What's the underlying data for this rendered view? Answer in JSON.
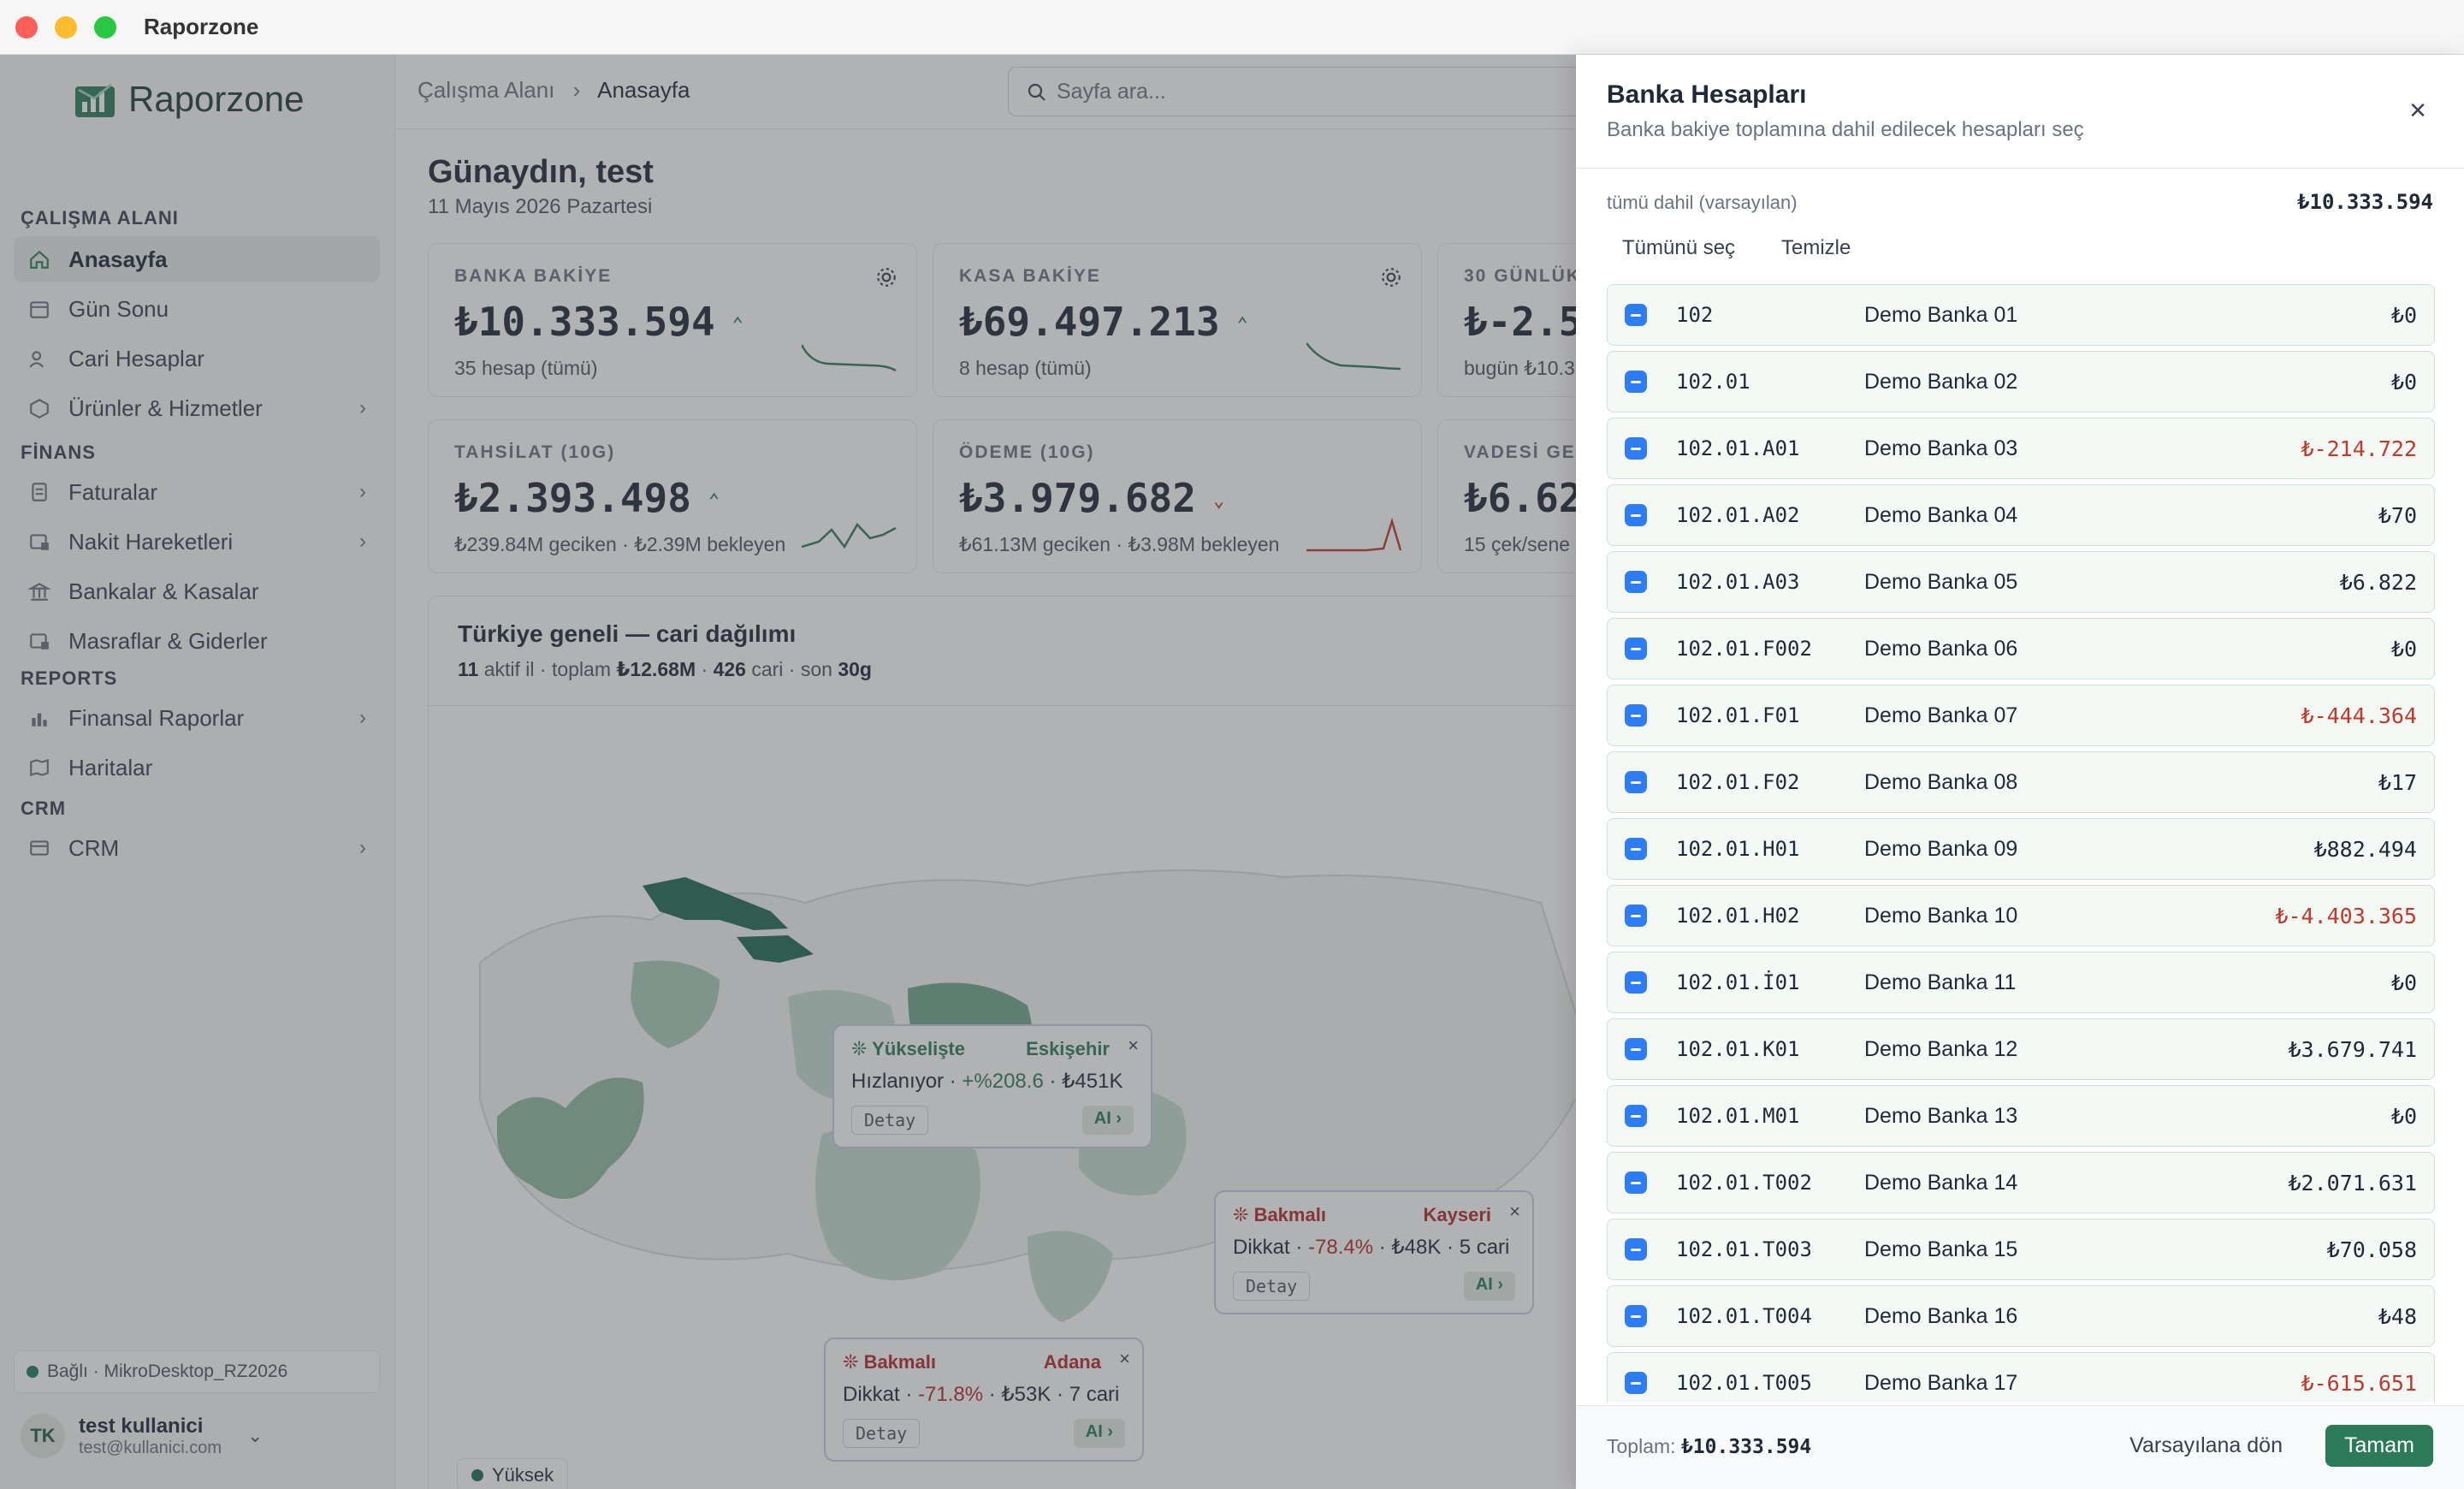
{
  "window": {
    "title": "Raporzone"
  },
  "sidebar": {
    "logo": "Raporzone",
    "sections": [
      {
        "title": "ÇALIŞMA ALANI",
        "items": [
          {
            "label": "Anasayfa",
            "icon": "home-icon",
            "active": true,
            "chevron": false
          },
          {
            "label": "Gün Sonu",
            "icon": "calendar-icon",
            "chevron": false
          },
          {
            "label": "Cari Hesaplar",
            "icon": "users-icon",
            "chevron": false
          },
          {
            "label": "Ürünler & Hizmetler",
            "icon": "box-icon",
            "chevron": true
          }
        ]
      },
      {
        "title": "FİNANS",
        "items": [
          {
            "label": "Faturalar",
            "icon": "invoice-icon",
            "chevron": true
          },
          {
            "label": "Nakit Hareketleri",
            "icon": "cash-icon",
            "chevron": true
          },
          {
            "label": "Bankalar & Kasalar",
            "icon": "bank-icon",
            "chevron": false
          },
          {
            "label": "Masraflar & Giderler",
            "icon": "expense-icon",
            "chevron": false
          }
        ]
      },
      {
        "title": "REPORTS",
        "items": [
          {
            "label": "Finansal Raporlar",
            "icon": "bar-chart-icon",
            "chevron": true
          },
          {
            "label": "Haritalar",
            "icon": "map-icon",
            "chevron": false
          }
        ]
      },
      {
        "title": "CRM",
        "items": [
          {
            "label": "CRM",
            "icon": "crm-icon",
            "chevron": true
          }
        ]
      }
    ],
    "connection": "Bağlı · MikroDesktop_RZ2026",
    "user": {
      "initials": "TK",
      "name": "test kullanici",
      "email": "test@kullanici.com"
    }
  },
  "main": {
    "breadcrumb": {
      "root": "Çalışma Alanı",
      "current": "Anasayfa"
    },
    "search_placeholder": "Sayfa ara...",
    "greeting": "Günaydın, test",
    "date": "11 Mayıs 2026 Pazartesi",
    "cards": [
      {
        "title": "BANKA BAKİYE",
        "value": "₺10.333.594",
        "sub": "35 hesap (tümü)",
        "trend": "up",
        "settings": true
      },
      {
        "title": "KASA BAKİYE",
        "value": "₺69.497.213",
        "sub": "8 hesap (tümü)",
        "trend": "up",
        "settings": true
      },
      {
        "title": "30 GÜNLÜK",
        "value": "₺-2.5",
        "sub": "bugün ₺10.3",
        "trend": "",
        "settings": false
      },
      {
        "title": "TAHSİLAT (10G)",
        "value": "₺2.393.498",
        "sub": "₺239.84M geciken · ₺2.39M bekleyen",
        "trend": "up",
        "settings": false
      },
      {
        "title": "ÖDEME (10G)",
        "value": "₺3.979.682",
        "sub": "₺61.13M geciken · ₺3.98M bekleyen",
        "trend": "down",
        "settings": false
      },
      {
        "title": "VADESİ GEÇ",
        "value": "₺6.62",
        "sub": "15 çek/sene",
        "trend": "",
        "settings": false
      }
    ],
    "map": {
      "title": "Türkiye geneli — cari dağılımı",
      "sub": {
        "provinces": "11",
        "provinces_label": "aktif il",
        "total_label": "toplam",
        "total": "₺12.68M",
        "count": "426",
        "count_label": "cari",
        "period_label": "son",
        "period": "30g"
      },
      "popups": [
        {
          "tag": "Yükselişte",
          "city": "Eskişehir",
          "label": "Hızlanıyor",
          "change": "+%208.6",
          "rest": "₺451K",
          "detail": "Detay",
          "ai": "AI",
          "tone": "up"
        },
        {
          "tag": "Bakmalı",
          "city": "Kayseri",
          "label": "Dikkat",
          "change": "-78.4%",
          "rest": "₺48K · 5 cari",
          "detail": "Detay",
          "ai": "AI",
          "tone": "down"
        },
        {
          "tag": "Bakmalı",
          "city": "Adana",
          "label": "Dikkat",
          "change": "-71.8%",
          "rest": "₺53K · 7 cari",
          "detail": "Detay",
          "ai": "AI",
          "tone": "down"
        }
      ],
      "legend": "Yüksek"
    }
  },
  "panel": {
    "title": "Banka Hesapları",
    "subtitle": "Banka bakiye toplamına dahil edilecek hesapları seç",
    "include_label": "tümü dahil (varsayılan)",
    "include_total": "₺10.333.594",
    "select_all": "Tümünü seç",
    "clear": "Temizle",
    "accounts": [
      {
        "code": "102",
        "name": "Demo Banka 01",
        "amount": "₺0",
        "neg": false
      },
      {
        "code": "102.01",
        "name": "Demo Banka 02",
        "amount": "₺0",
        "neg": false
      },
      {
        "code": "102.01.A01",
        "name": "Demo Banka 03",
        "amount": "₺-214.722",
        "neg": true
      },
      {
        "code": "102.01.A02",
        "name": "Demo Banka 04",
        "amount": "₺70",
        "neg": false
      },
      {
        "code": "102.01.A03",
        "name": "Demo Banka 05",
        "amount": "₺6.822",
        "neg": false
      },
      {
        "code": "102.01.F002",
        "name": "Demo Banka 06",
        "amount": "₺0",
        "neg": false
      },
      {
        "code": "102.01.F01",
        "name": "Demo Banka 07",
        "amount": "₺-444.364",
        "neg": true
      },
      {
        "code": "102.01.F02",
        "name": "Demo Banka 08",
        "amount": "₺17",
        "neg": false
      },
      {
        "code": "102.01.H01",
        "name": "Demo Banka 09",
        "amount": "₺882.494",
        "neg": false
      },
      {
        "code": "102.01.H02",
        "name": "Demo Banka 10",
        "amount": "₺-4.403.365",
        "neg": true
      },
      {
        "code": "102.01.İ01",
        "name": "Demo Banka 11",
        "amount": "₺0",
        "neg": false
      },
      {
        "code": "102.01.K01",
        "name": "Demo Banka 12",
        "amount": "₺3.679.741",
        "neg": false
      },
      {
        "code": "102.01.M01",
        "name": "Demo Banka 13",
        "amount": "₺0",
        "neg": false
      },
      {
        "code": "102.01.T002",
        "name": "Demo Banka 14",
        "amount": "₺2.071.631",
        "neg": false
      },
      {
        "code": "102.01.T003",
        "name": "Demo Banka 15",
        "amount": "₺70.058",
        "neg": false
      },
      {
        "code": "102.01.T004",
        "name": "Demo Banka 16",
        "amount": "₺48",
        "neg": false
      },
      {
        "code": "102.01.T005",
        "name": "Demo Banka 17",
        "amount": "₺-615.651",
        "neg": true
      }
    ],
    "total_label": "Toplam:",
    "total": "₺10.333.594",
    "reset": "Varsayılana dön",
    "ok": "Tamam"
  },
  "colors": {
    "accent": "#2d7a58",
    "negative": "#c0392b",
    "checkbox": "#2f7df6",
    "overlay": "rgba(70,72,76,0.42)"
  }
}
